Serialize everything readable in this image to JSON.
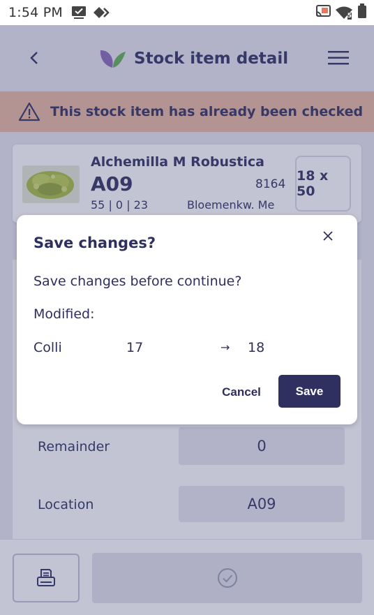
{
  "status_bar": {
    "time": "1:54 PM",
    "left_icons": [
      "checkbox-notification-icon",
      "diamond-arrows-icon"
    ],
    "right_icons": [
      "cast-icon",
      "wifi-icon",
      "battery-icon"
    ],
    "wifi_badge": "5"
  },
  "header": {
    "title": "Stock item detail",
    "logo_colors": [
      "#8a67b8",
      "#5fb04e"
    ]
  },
  "banner": {
    "text": "This stock item has already been checked",
    "color": "#e7b89e"
  },
  "item": {
    "name": "Alchemilla M Robustica",
    "code": "A09",
    "number": "8164",
    "counts": "55 | 0 | 23",
    "supplier": "Bloemenkw. Me",
    "size": "18 x 50"
  },
  "form": {
    "remainder_label": "Remainder",
    "remainder_value": "0",
    "location_label": "Location",
    "location_value": "A09"
  },
  "dialog": {
    "title": "Save changes?",
    "message": "Save changes before continue?",
    "modified_label": "Modified:",
    "change": {
      "field": "Colli",
      "old_value": "17",
      "arrow": "→",
      "new_value": "18"
    },
    "cancel_label": "Cancel",
    "save_label": "Save"
  },
  "colors": {
    "primary": "#2f3060",
    "background": "#e6e6f1",
    "warning": "#e7b89e"
  }
}
